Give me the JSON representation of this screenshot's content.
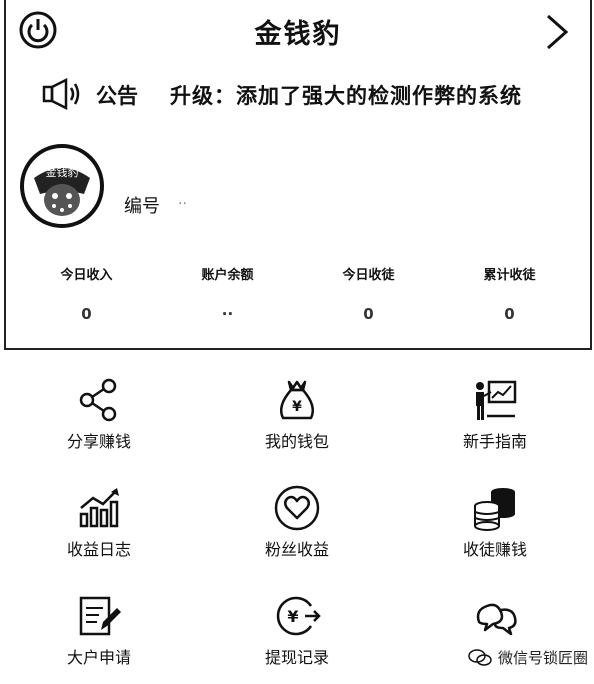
{
  "header": {
    "title": "金钱豹"
  },
  "notice": {
    "label": "公告",
    "text": "升级：添加了强大的检测作弊的系统"
  },
  "profile": {
    "avatar_text": "金钱豹",
    "uid_label": "编号",
    "uid_value": "··"
  },
  "stats": [
    {
      "label": "今日收入",
      "value": "0"
    },
    {
      "label": "账户余额",
      "value": "··"
    },
    {
      "label": "今日收徒",
      "value": "0"
    },
    {
      "label": "累计收徒",
      "value": "0"
    }
  ],
  "menu": [
    {
      "label": "分享赚钱",
      "icon": "share-icon"
    },
    {
      "label": "我的钱包",
      "icon": "money-bag-icon"
    },
    {
      "label": "新手指南",
      "icon": "presentation-icon"
    },
    {
      "label": "收益日志",
      "icon": "growth-chart-icon"
    },
    {
      "label": "粉丝收益",
      "icon": "heart-icon"
    },
    {
      "label": "收徒赚钱",
      "icon": "coins-icon"
    },
    {
      "label": "大户申请",
      "icon": "edit-icon"
    },
    {
      "label": "提现记录",
      "icon": "withdraw-icon"
    },
    {
      "label": "",
      "icon": "chat-icon"
    }
  ],
  "watermark": {
    "text": "微信号锁匠圈"
  }
}
